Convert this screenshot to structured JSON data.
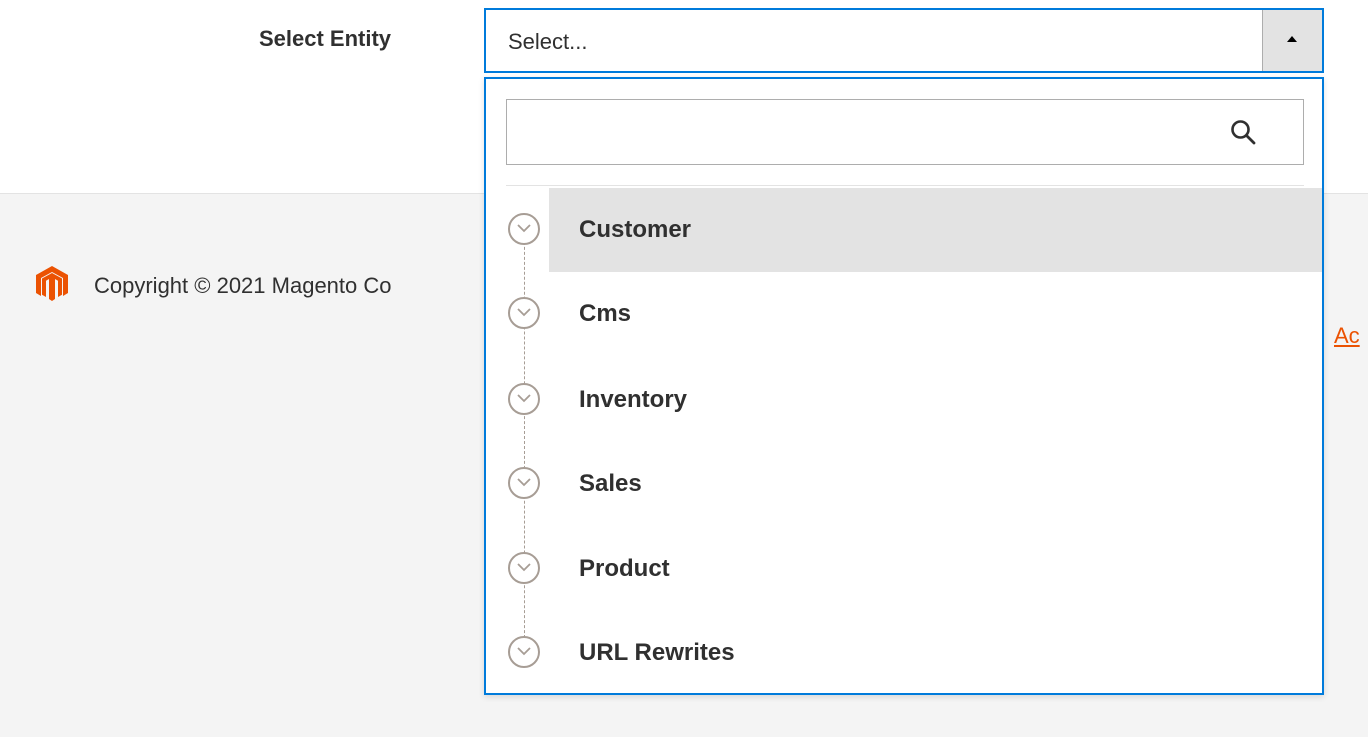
{
  "form": {
    "label": "Select Entity",
    "select_value": "Select...",
    "toggle_direction": "up"
  },
  "dropdown": {
    "search_value": "",
    "search_placeholder": "",
    "search_icon": "search-icon",
    "options": [
      {
        "label": "Customer",
        "highlighted": true,
        "icon": "chevron-down-icon"
      },
      {
        "label": "Cms",
        "highlighted": false,
        "icon": "chevron-down-icon"
      },
      {
        "label": "Inventory",
        "highlighted": false,
        "icon": "chevron-down-icon"
      },
      {
        "label": "Sales",
        "highlighted": false,
        "icon": "chevron-down-icon"
      },
      {
        "label": "Product",
        "highlighted": false,
        "icon": "chevron-down-icon"
      },
      {
        "label": "URL Rewrites",
        "highlighted": false,
        "icon": "chevron-down-icon"
      }
    ]
  },
  "footer": {
    "logo_icon": "magento-logo-icon",
    "copyright_text": "Copyright © 2021 Magento Co",
    "link_text": "Ac"
  },
  "colors": {
    "accent_border": "#007bdb",
    "brand_orange": "#eb5202",
    "footer_bg": "#f4f4f4",
    "highlight_bg": "#e3e3e3",
    "text": "#303030"
  }
}
